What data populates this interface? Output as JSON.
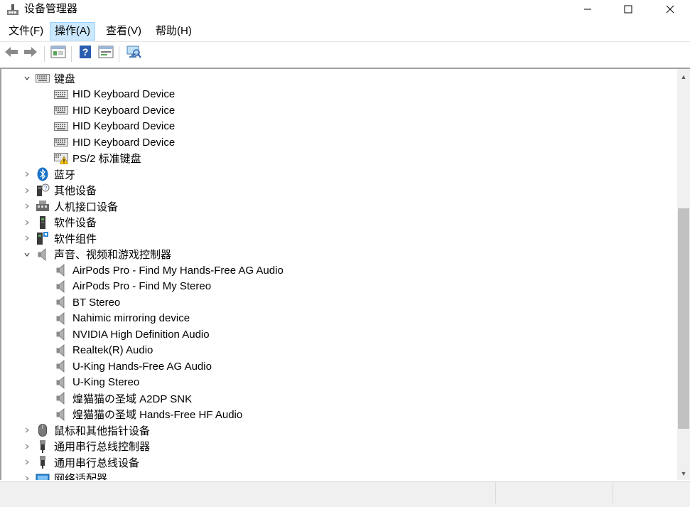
{
  "window": {
    "title": "设备管理器",
    "app_icon": "device-manager-icon",
    "controls": [
      "minimize-icon",
      "maximize-icon",
      "close-icon"
    ]
  },
  "menu": {
    "items": [
      {
        "label": "文件(F)"
      },
      {
        "label": "操作(A)",
        "active": true
      },
      {
        "label": "查看(V)"
      },
      {
        "label": "帮助(H)"
      }
    ]
  },
  "toolbar": {
    "buttons": [
      "back-arrow-icon",
      "forward-arrow-icon",
      "properties-icon",
      "help-icon",
      "update-driver-icon",
      "scan-hardware-icon"
    ]
  },
  "tree": {
    "rows": [
      {
        "label": "键盘",
        "level": 0,
        "expanded": true,
        "icon": "keyboard-icon"
      },
      {
        "label": "HID Keyboard Device",
        "level": 1,
        "icon": "keyboard-icon"
      },
      {
        "label": "HID Keyboard Device",
        "level": 1,
        "icon": "keyboard-icon"
      },
      {
        "label": "HID Keyboard Device",
        "level": 1,
        "icon": "keyboard-icon"
      },
      {
        "label": "HID Keyboard Device",
        "level": 1,
        "icon": "keyboard-icon"
      },
      {
        "label": "PS/2 标准键盘",
        "level": 1,
        "icon": "keyboard-warning-icon"
      },
      {
        "label": "蓝牙",
        "level": 0,
        "expanded": false,
        "icon": "bluetooth-icon"
      },
      {
        "label": "其他设备",
        "level": 0,
        "expanded": false,
        "icon": "unknown-device-icon"
      },
      {
        "label": "人机接口设备",
        "level": 0,
        "expanded": false,
        "icon": "hid-icon"
      },
      {
        "label": "软件设备",
        "level": 0,
        "expanded": false,
        "icon": "software-device-icon"
      },
      {
        "label": "软件组件",
        "level": 0,
        "expanded": false,
        "icon": "software-component-icon"
      },
      {
        "label": "声音、视频和游戏控制器",
        "level": 0,
        "expanded": true,
        "icon": "speaker-icon"
      },
      {
        "label": "AirPods Pro - Find My Hands-Free AG Audio",
        "level": 1,
        "icon": "speaker-icon"
      },
      {
        "label": "AirPods Pro - Find My Stereo",
        "level": 1,
        "icon": "speaker-icon"
      },
      {
        "label": "BT Stereo",
        "level": 1,
        "icon": "speaker-icon"
      },
      {
        "label": "Nahimic mirroring device",
        "level": 1,
        "icon": "speaker-icon"
      },
      {
        "label": "NVIDIA High Definition Audio",
        "level": 1,
        "icon": "speaker-icon"
      },
      {
        "label": "Realtek(R) Audio",
        "level": 1,
        "icon": "speaker-icon"
      },
      {
        "label": "U-King Hands-Free AG Audio",
        "level": 1,
        "icon": "speaker-icon"
      },
      {
        "label": "U-King Stereo",
        "level": 1,
        "icon": "speaker-icon"
      },
      {
        "label": "煌猫猫の圣域 A2DP SNK",
        "level": 1,
        "icon": "speaker-icon"
      },
      {
        "label": "煌猫猫の圣域 Hands-Free HF Audio",
        "level": 1,
        "icon": "speaker-icon"
      },
      {
        "label": "鼠标和其他指针设备",
        "level": 0,
        "expanded": false,
        "icon": "mouse-icon"
      },
      {
        "label": "通用串行总线控制器",
        "level": 0,
        "expanded": false,
        "icon": "usb-icon"
      },
      {
        "label": "通用串行总线设备",
        "level": 0,
        "expanded": false,
        "icon": "usb-icon"
      },
      {
        "label": "网络适配器",
        "level": 0,
        "expanded": false,
        "icon": "network-adapter-icon"
      }
    ]
  },
  "colors": {
    "menu_active_bg": "#cce8ff",
    "menu_active_border": "#99d1ff",
    "scroll_thumb": "#c1c1c1",
    "statusbar_bg": "#f0f0f0"
  }
}
